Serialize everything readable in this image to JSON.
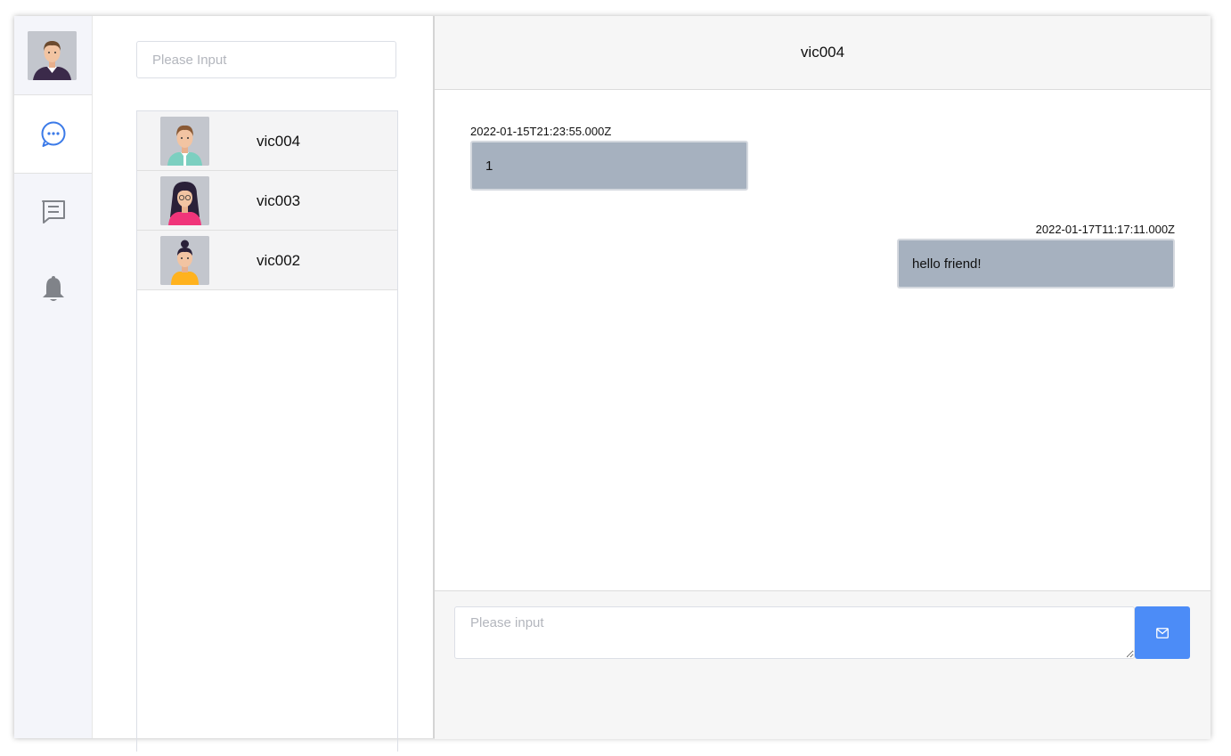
{
  "sidebar": {
    "user_avatar": "man-avatar",
    "nav": [
      {
        "icon": "chat-bubble-icon",
        "active": true
      },
      {
        "icon": "message-icon",
        "active": false
      },
      {
        "icon": "bell-icon",
        "active": false
      }
    ],
    "accent_color": "#3b7ae8",
    "inactive_color": "#808389"
  },
  "contacts": {
    "search_placeholder": "Please Input",
    "items": [
      {
        "name": "vic004",
        "avatar": "man-avatar"
      },
      {
        "name": "vic003",
        "avatar": "woman-avatar"
      },
      {
        "name": "vic002",
        "avatar": "woman-bun-avatar"
      }
    ]
  },
  "chat": {
    "title": "vic004",
    "messages": [
      {
        "time": "2022-01-15T21:23:55.000Z",
        "text": "1",
        "side": "left"
      },
      {
        "time": "2022-01-17T11:17:11.000Z",
        "text": "hello friend!",
        "side": "right"
      }
    ],
    "input_placeholder": "Please input",
    "send_icon": "envelope-icon",
    "send_color": "#4c8cf7"
  }
}
